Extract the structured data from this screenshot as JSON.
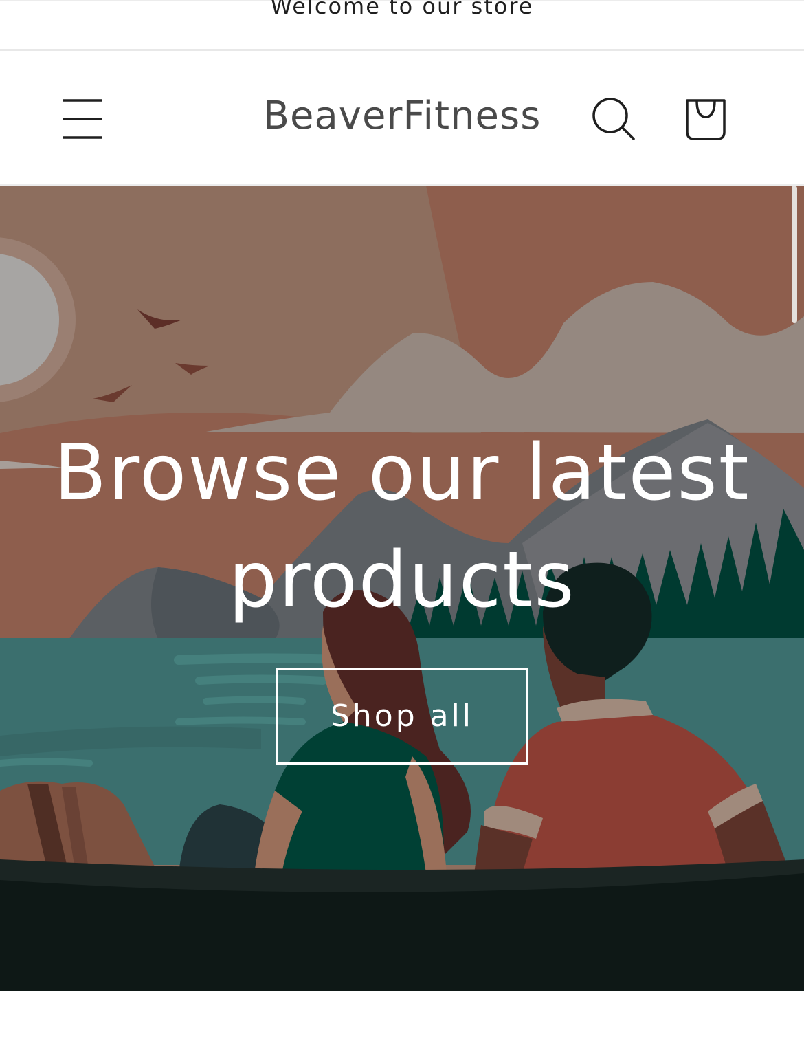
{
  "announcement": {
    "text": "Welcome to our store"
  },
  "header": {
    "logo_text": "BeaverFitness",
    "icons": {
      "menu": "hamburger-menu-icon",
      "search": "search-icon",
      "cart": "cart-icon"
    }
  },
  "hero": {
    "heading": "Browse our latest products",
    "cta_label": "Shop all"
  },
  "colors": {
    "hero_overlay_text": "#ffffff",
    "logo": "#4a4a4a",
    "sky": "#8b7060",
    "water": "#3b6f6e",
    "ground": "#0e1816"
  }
}
